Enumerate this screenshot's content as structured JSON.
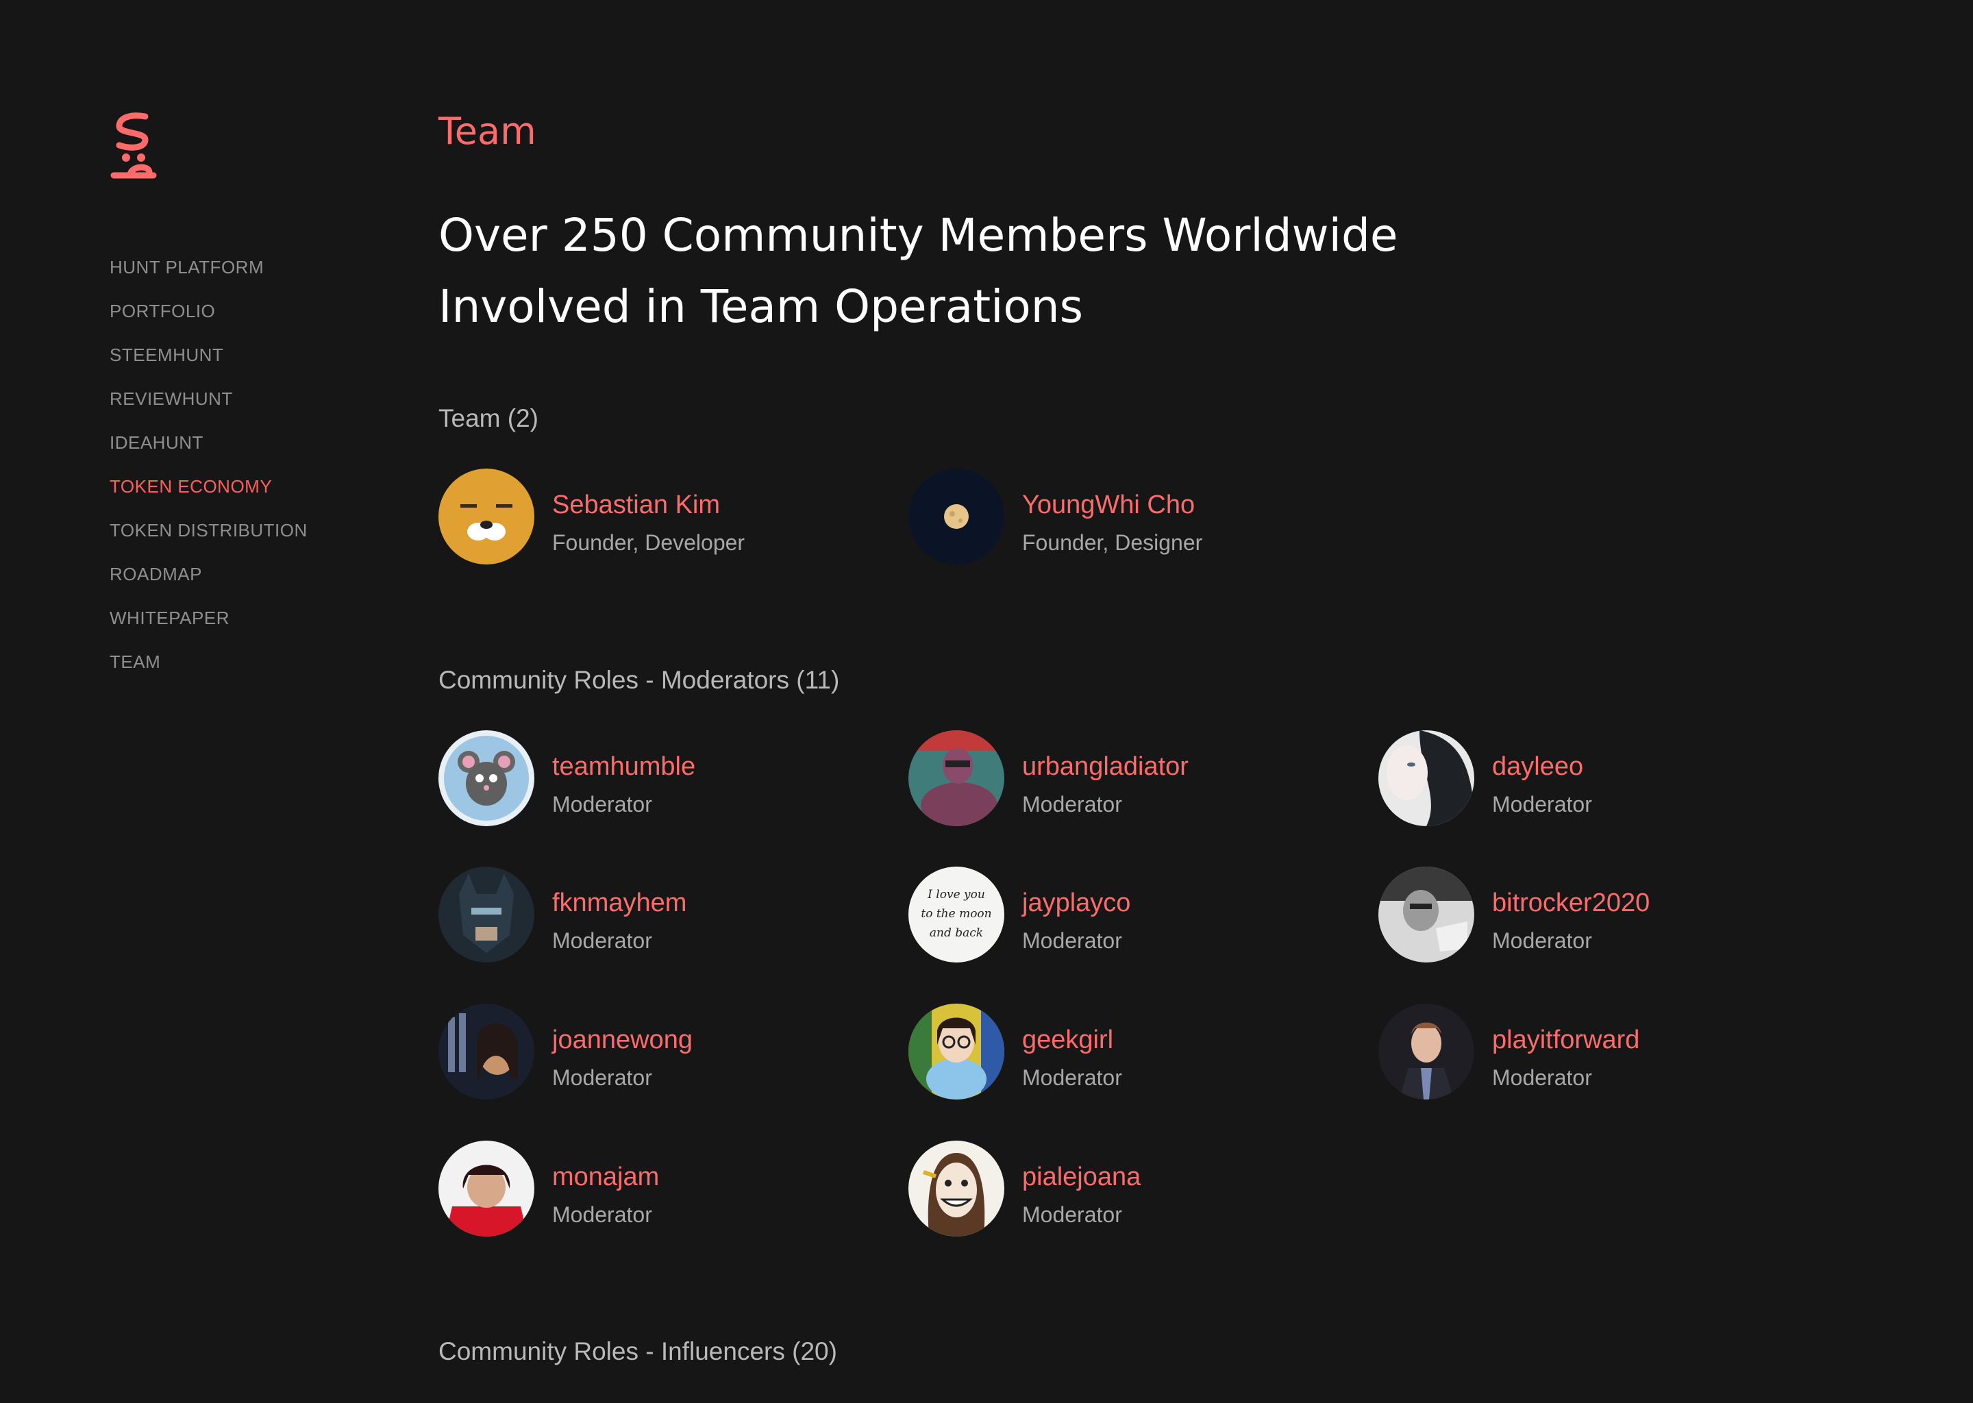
{
  "logo": {
    "alt": "Hunt logo",
    "color": "#ff6b6b"
  },
  "sidebar": {
    "items": [
      {
        "label": "HUNT PLATFORM",
        "active": false
      },
      {
        "label": "PORTFOLIO",
        "active": false
      },
      {
        "label": "STEEMHUNT",
        "active": false
      },
      {
        "label": "REVIEWHUNT",
        "active": false
      },
      {
        "label": "IDEAHUNT",
        "active": false
      },
      {
        "label": "TOKEN ECONOMY",
        "active": true
      },
      {
        "label": "TOKEN DISTRIBUTION",
        "active": false
      },
      {
        "label": "ROADMAP",
        "active": false
      },
      {
        "label": "WHITEPAPER",
        "active": false
      },
      {
        "label": "TEAM",
        "active": false
      }
    ]
  },
  "main": {
    "section_label": "Team",
    "headline_line1": "Over 250 Community Members Worldwide",
    "headline_line2": "Involved in Team Operations",
    "team_title": "Team (2)",
    "moderators_title": "Community Roles - Moderators (11)",
    "influencers_title": "Community Roles - Influencers (20)",
    "team": [
      {
        "name": "Sebastian Kim",
        "role": "Founder, Developer",
        "avatar": "bear-face-avatar"
      },
      {
        "name": "YoungWhi Cho",
        "role": "Founder, Designer",
        "avatar": "moon-night-avatar"
      }
    ],
    "moderators": [
      {
        "name": "teamhumble",
        "role": "Moderator",
        "avatar": "mouse-cartoon-avatar"
      },
      {
        "name": "urbangladiator",
        "role": "Moderator",
        "avatar": "masked-hero-avatar"
      },
      {
        "name": "dayleeo",
        "role": "Moderator",
        "avatar": "dark-hair-portrait-avatar"
      },
      {
        "name": "fknmayhem",
        "role": "Moderator",
        "avatar": "batman-avatar"
      },
      {
        "name": "jayplayco",
        "role": "Moderator",
        "avatar": "handwritten-quote-avatar"
      },
      {
        "name": "bitrocker2020",
        "role": "Moderator",
        "avatar": "bw-photo-avatar"
      },
      {
        "name": "joannewong",
        "role": "Moderator",
        "avatar": "city-night-portrait-avatar"
      },
      {
        "name": "geekgirl",
        "role": "Moderator",
        "avatar": "glasses-cartoon-avatar"
      },
      {
        "name": "playitforward",
        "role": "Moderator",
        "avatar": "suit-portrait-avatar"
      },
      {
        "name": "monajam",
        "role": "Moderator",
        "avatar": "red-shirt-portrait-avatar"
      },
      {
        "name": "pialejoana",
        "role": "Moderator",
        "avatar": "grin-drawing-avatar"
      }
    ],
    "avatar_quote": "I love you to the moon and back"
  },
  "colors": {
    "background": "#161616",
    "accent": "#ff6b6b",
    "nav_text": "#8f8f8f",
    "role_text": "#a8a8a8"
  }
}
